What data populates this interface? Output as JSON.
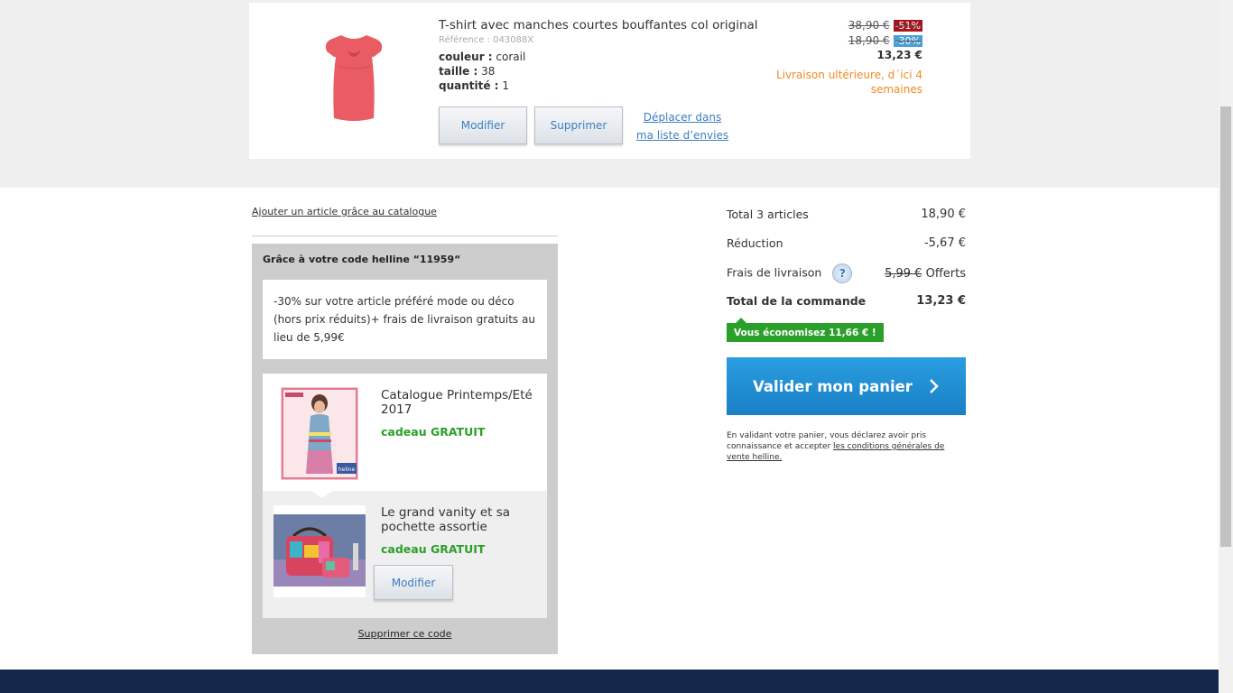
{
  "product": {
    "title": "T-shirt avec manches courtes bouffantes col original",
    "reference": "Référence : 043088X",
    "color_label": "couleur :",
    "color_value": "corail",
    "size_label": "taille :",
    "size_value": "38",
    "qty_label": "quantité :",
    "qty_value": "1",
    "modify_label": "Modifier",
    "delete_label": "Supprimer",
    "move_label": "Déplacer dans ma liste d’envies",
    "price_original": "38,90 €",
    "discount_1": "-51%",
    "price_reduced": "18,90 €",
    "discount_2": "-30%",
    "price_final": "13,23 €",
    "delivery_note": "Livraison ultérieure, d´ici 4 semaines",
    "colors": {
      "discount_1_bg": "#a6151b",
      "discount_2_bg": "#4aa0d4",
      "garment": "#e95c63"
    }
  },
  "add_article_link": "Ajouter un article grâce au catalogue",
  "promo": {
    "title": "Grâce à votre code helline “11959“",
    "description": "-30% sur votre article préféré mode ou déco (hors prix réduits)+ frais de livraison gratuits au lieu de 5,99€",
    "gifts": [
      {
        "title": "Catalogue Printemps/Eté 2017",
        "free_label": "cadeau GRATUIT",
        "brand": "heline"
      },
      {
        "title": "Le grand vanity et sa pochette assortie",
        "free_label": "cadeau GRATUIT",
        "modify_label": "Modifier"
      }
    ],
    "remove_code_label": "Supprimer ce code"
  },
  "summary": {
    "total_articles_label": "Total 3 articles",
    "total_articles_value": "18,90 €",
    "reduction_label": "Réduction",
    "reduction_value": "-5,67 €",
    "shipping_label": "Frais de livraison",
    "shipping_help": "?",
    "shipping_old": "5,99 €",
    "shipping_value": "Offerts",
    "order_total_label": "Total de la commande",
    "order_total_value": "13,23 €",
    "savings_badge": "Vous économisez 11,66 € !",
    "validate_label": "Valider mon panier",
    "legal_text": "En validant votre panier, vous déclarez avoir pris connaissance et accepter ",
    "legal_link": "les conditions générales de vente helline."
  }
}
